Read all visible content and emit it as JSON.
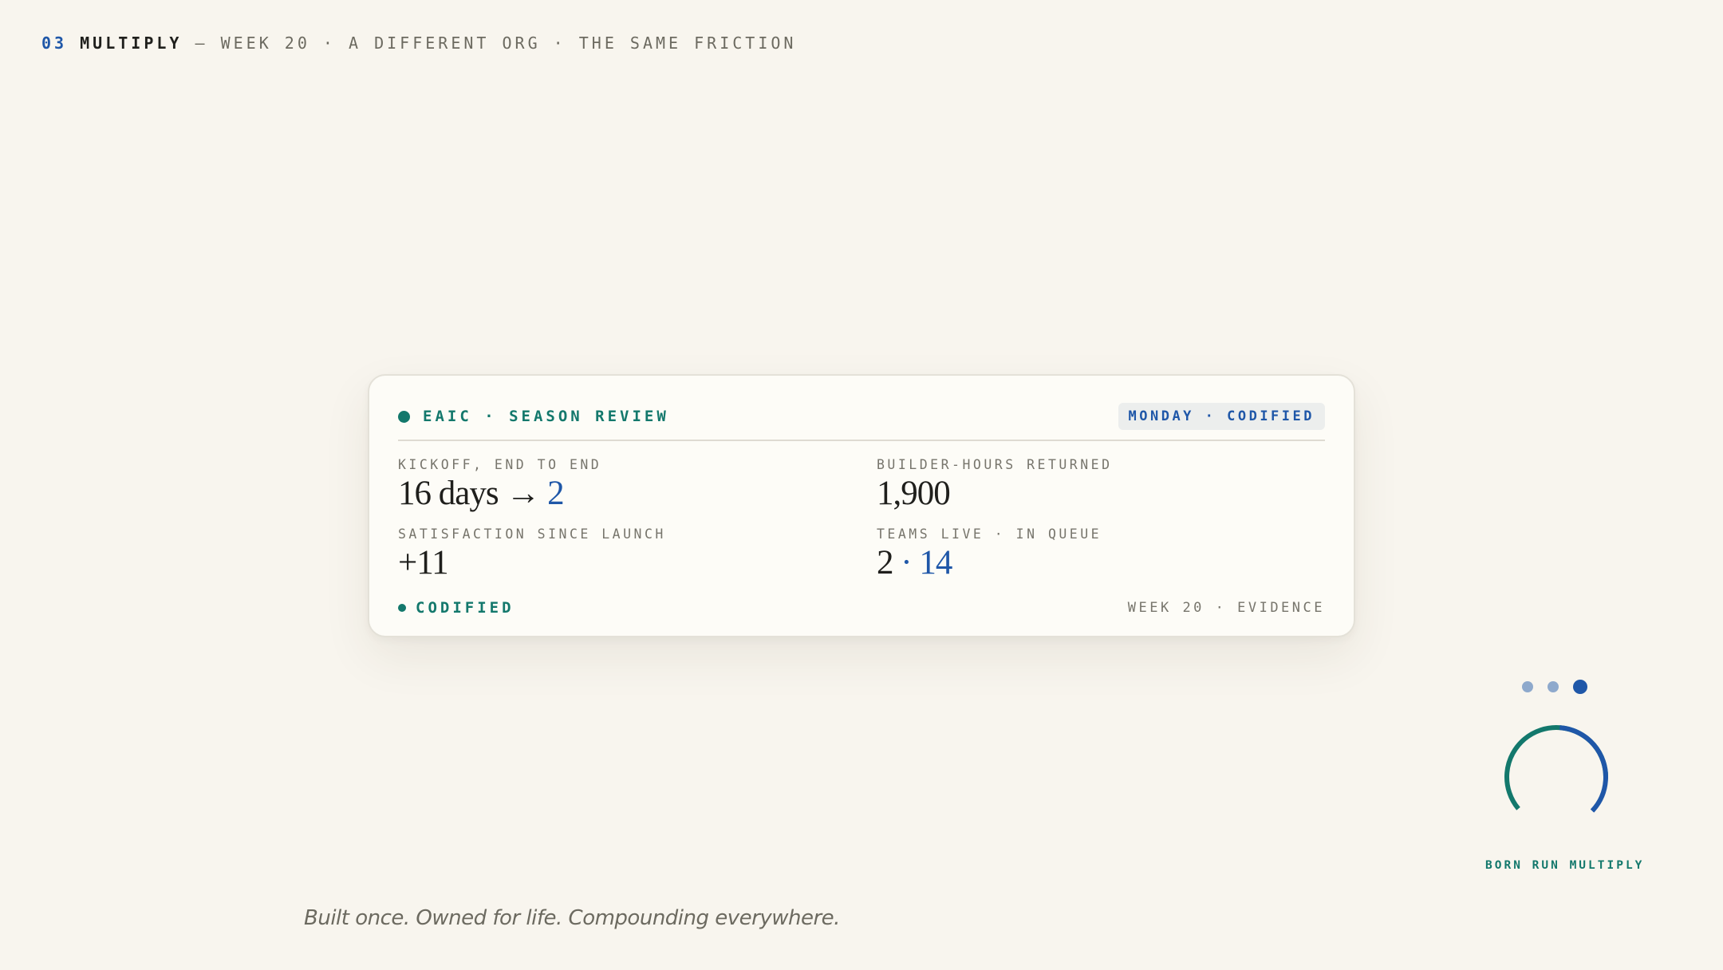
{
  "header": {
    "number": "03",
    "section": "MULTIPLY",
    "subtitle": " — WEEK 20 · A DIFFERENT ORG · THE SAME FRICTION"
  },
  "card": {
    "title": "EAIC · SEASON REVIEW",
    "badge": "MONDAY · CODIFIED",
    "stats": [
      {
        "label": "KICKOFF, END TO END",
        "value_main": "16 days → ",
        "value_accent": "2"
      },
      {
        "label": "BUILDER-HOURS RETURNED",
        "value_main": "1,900",
        "value_accent": ""
      },
      {
        "label": "SATISFACTION SINCE LAUNCH",
        "value_main": "+11",
        "value_accent": ""
      },
      {
        "label": "TEAMS LIVE · IN QUEUE",
        "value_main": "2",
        "value_accent": " · 14"
      }
    ],
    "footer_status": "CODIFIED",
    "footer_meta": "WEEK 20 · EVIDENCE"
  },
  "progress": {
    "steps": 3,
    "active_index": 2
  },
  "ring": {
    "label": "BORN RUN MULTIPLY"
  },
  "tagline": "Built once. Owned for life. Compounding everywhere.",
  "colors": {
    "background": "#f8f5ee",
    "teal": "#13786c",
    "blue": "#1f57a8",
    "muted": "#77756c",
    "ink": "#1f1f1c"
  }
}
